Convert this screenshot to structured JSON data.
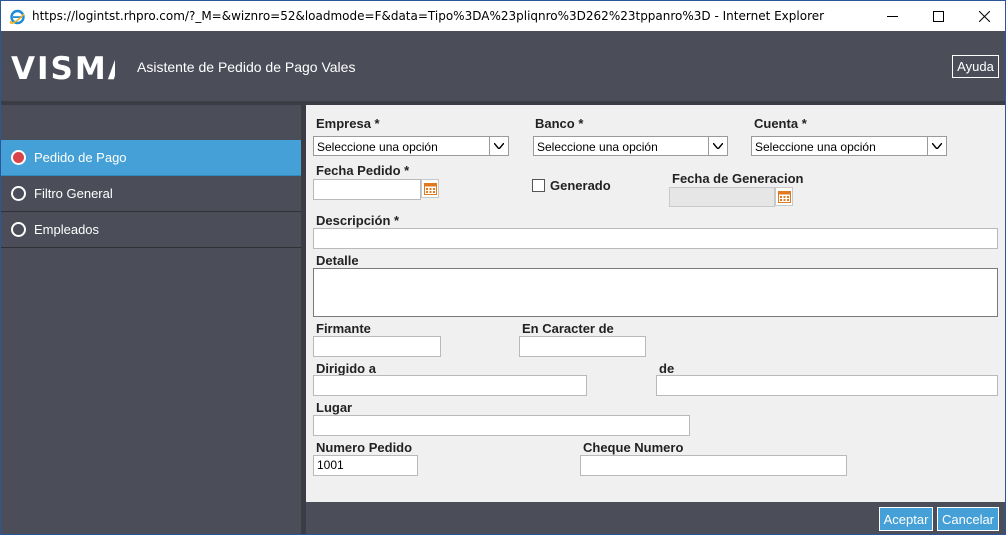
{
  "window": {
    "title": "https://logintst.rhpro.com/?_M=&wiznro=52&loadmode=F&data=Tipo%3DA%23pliqnro%3D262%23tppanro%3D - Internet Explorer",
    "app_icon": "internet-explorer-icon",
    "controls": {
      "minimize": "minimize-icon",
      "maximize": "maximize-icon",
      "close": "close-icon"
    }
  },
  "header": {
    "logo": "VISMA",
    "title": "Asistente de Pedido de Pago Vales",
    "help_label": "Ayuda"
  },
  "sidebar": {
    "items": [
      {
        "label": "Pedido de Pago",
        "active": true
      },
      {
        "label": "Filtro General",
        "active": false
      },
      {
        "label": "Empleados",
        "active": false
      }
    ]
  },
  "form": {
    "empresa": {
      "label": "Empresa",
      "required": "*",
      "value": "Seleccione una opción"
    },
    "banco": {
      "label": "Banco",
      "required": "*",
      "value": "Seleccione una opción"
    },
    "cuenta": {
      "label": "Cuenta",
      "required": "*",
      "value": "Seleccione una opción"
    },
    "fecha_pedido": {
      "label": "Fecha Pedido",
      "required": "*",
      "value": ""
    },
    "generado": {
      "label": "Generado",
      "checked": false
    },
    "fecha_generacion": {
      "label": "Fecha de Generacion",
      "value": ""
    },
    "descripcion": {
      "label": "Descripción",
      "required": "*",
      "value": ""
    },
    "detalle": {
      "label": "Detalle",
      "value": ""
    },
    "firmante": {
      "label": "Firmante",
      "value": ""
    },
    "en_caracter_de": {
      "label": "En Caracter de",
      "value": ""
    },
    "dirigido_a": {
      "label": "Dirigido a",
      "value": ""
    },
    "de": {
      "label": "de",
      "value": ""
    },
    "lugar": {
      "label": "Lugar",
      "value": ""
    },
    "numero_pedido": {
      "label": "Numero Pedido",
      "value": "1001"
    },
    "cheque_numero": {
      "label": "Cheque Numero",
      "value": ""
    }
  },
  "footer": {
    "accept_label": "Aceptar",
    "cancel_label": "Cancelar"
  },
  "colors": {
    "header_bg": "#4b4e58",
    "accent": "#44a0d6",
    "active_radio": "#d8444a",
    "form_bg": "#f0f0f0"
  }
}
